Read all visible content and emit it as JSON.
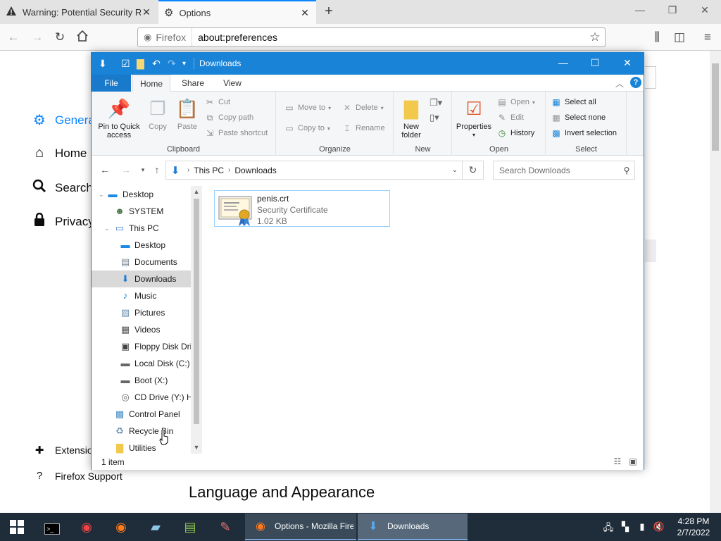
{
  "browser": {
    "tabs": [
      {
        "title": "Warning: Potential Security Risk Ahead",
        "icon": "warning-icon"
      },
      {
        "title": "Options",
        "icon": "gear-icon"
      }
    ],
    "identity_label": "Firefox",
    "url": "about:preferences"
  },
  "prefs": {
    "categories": [
      {
        "label": "General",
        "icon": "gear-icon"
      },
      {
        "label": "Home",
        "icon": "home-icon"
      },
      {
        "label": "Search",
        "icon": "search-icon"
      },
      {
        "label": "Privacy",
        "icon": "lock-icon"
      }
    ],
    "footer": [
      {
        "label": "Extensions",
        "icon": "puzzle-icon"
      },
      {
        "label": "Firefox Support",
        "icon": "help-icon"
      }
    ],
    "section_heading": "Language and Appearance"
  },
  "explorer": {
    "title": "Downloads",
    "ribbon_tabs": [
      "File",
      "Home",
      "Share",
      "View"
    ],
    "clipboard": {
      "pin": "Pin to Quick access",
      "copy": "Copy",
      "paste": "Paste",
      "cut": "Cut",
      "copy_path": "Copy path",
      "paste_shortcut": "Paste shortcut",
      "label": "Clipboard"
    },
    "organize": {
      "move_to": "Move to",
      "copy_to": "Copy to",
      "delete": "Delete",
      "rename": "Rename",
      "label": "Organize"
    },
    "new": {
      "new_folder": "New folder",
      "label": "New"
    },
    "open": {
      "properties": "Properties",
      "open": "Open",
      "edit": "Edit",
      "history": "History",
      "label": "Open"
    },
    "select": {
      "select_all": "Select all",
      "select_none": "Select none",
      "invert": "Invert selection",
      "label": "Select"
    },
    "breadcrumb": [
      "This PC",
      "Downloads"
    ],
    "search_placeholder": "Search Downloads",
    "nav_items": [
      {
        "label": "Desktop",
        "icon": "desktop-icon",
        "level": 0
      },
      {
        "label": "SYSTEM",
        "icon": "user-icon",
        "level": 1
      },
      {
        "label": "This PC",
        "icon": "computer-icon",
        "level": 1
      },
      {
        "label": "Desktop",
        "icon": "desktop-icon",
        "level": 2
      },
      {
        "label": "Documents",
        "icon": "documents-icon",
        "level": 2
      },
      {
        "label": "Downloads",
        "icon": "downloads-icon",
        "level": 2,
        "selected": true
      },
      {
        "label": "Music",
        "icon": "music-icon",
        "level": 2
      },
      {
        "label": "Pictures",
        "icon": "pictures-icon",
        "level": 2
      },
      {
        "label": "Videos",
        "icon": "videos-icon",
        "level": 2
      },
      {
        "label": "Floppy Disk Drive (A:)",
        "icon": "floppy-icon",
        "level": 2
      },
      {
        "label": "Local Disk (C:)",
        "icon": "disk-icon",
        "level": 2
      },
      {
        "label": "Boot (X:)",
        "icon": "disk-icon",
        "level": 2
      },
      {
        "label": "CD Drive (Y:) H",
        "icon": "cd-icon",
        "level": 2
      },
      {
        "label": "Control Panel",
        "icon": "control-panel-icon",
        "level": 1
      },
      {
        "label": "Recycle Bin",
        "icon": "recycle-bin-icon",
        "level": 1
      },
      {
        "label": "Utilities",
        "icon": "folder-icon",
        "level": 1
      }
    ],
    "files": [
      {
        "name": "penis.crt",
        "type": "Security Certificate",
        "size": "1.02 KB"
      }
    ],
    "status": "1 item"
  },
  "taskbar": {
    "pinned": [
      "start-icon",
      "terminal-icon",
      "chrome-icon",
      "firefox-icon",
      "notepad-icon",
      "spreadsheet-icon",
      "paint-icon"
    ],
    "tasks": [
      {
        "label": "Options - Mozilla Firefox",
        "icon": "firefox-icon"
      },
      {
        "label": "Downloads",
        "icon": "downloads-icon"
      }
    ],
    "time": "4:28 PM",
    "date": "2/7/2022"
  },
  "colors": {
    "explorer_accent": "#1883d7",
    "firefox_accent": "#0a84ff",
    "taskbar": "#1f2d3a"
  }
}
